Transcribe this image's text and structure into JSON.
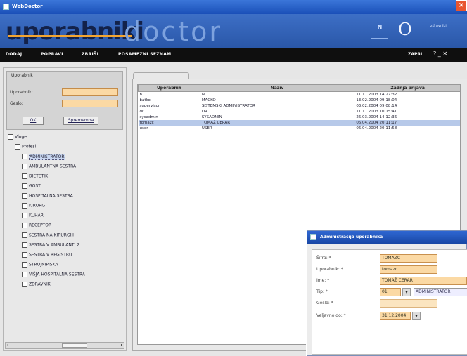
{
  "window": {
    "title": "WebDoctor"
  },
  "banner": {
    "logo_primary": "uporabniki",
    "logo_secondary": "doctor",
    "brand_n": "N",
    "brand_o": "O",
    "brand_text": "zdravniki"
  },
  "menu": {
    "items": [
      "DODAJ",
      "POPRAVI",
      "ZBRIŠI",
      "POSAMEZNI SEZNAM"
    ],
    "exit_label": "ZAPRI"
  },
  "login": {
    "legend": "Uporabnik",
    "username_label": "Uporabnik:",
    "password_label": "Geslo:",
    "username_value": "",
    "password_value": "",
    "ok_label": "OK",
    "change_label": "Sprememba"
  },
  "tree": {
    "root": "Vloge",
    "group": "Profesi",
    "items": [
      "ADMINISTRATOR",
      "AMBULANTNA SESTRA",
      "DIETETIK",
      "GOST",
      "HOSPITALNA SESTRA",
      "KIRURG",
      "KUHAR",
      "RECEPTOR",
      "SESTRA NA KIRURGIJI",
      "SESTRA V AMBULANTI 2",
      "SESTRA V REGISTRU",
      "STROJNIPISKA",
      "VIŠJA HOSPITALNA SESTRA",
      "ZDRAVNIK"
    ]
  },
  "grid": {
    "columns": [
      "Uporabnik",
      "Naziv",
      "Zadnja prijava"
    ],
    "rows": [
      [
        "n",
        "N",
        "11.11.2003 14:27:32"
      ],
      [
        "batko",
        "MAČKO",
        "13.02.2004 09:18:04"
      ],
      [
        "supervisor",
        "SISTEMSKI ADMINISTRATOR",
        "03.02.2004 09:08:14"
      ],
      [
        "dr",
        "DR",
        "11.11.2003 10:15:41"
      ],
      [
        "sysadmin",
        "SYSADMIN",
        "26.03.2004 14:12:36"
      ],
      [
        "tomazc",
        "TOMAŽ CERAR",
        "06.04.2004 20:11:17"
      ],
      [
        "user",
        "USER",
        "06.04.2004 20:11:58"
      ]
    ],
    "selected_row": 5
  },
  "dialog": {
    "title": "Administracija uporabnika",
    "fields": {
      "name_label": "Šifra: *",
      "name_value": "TOMAZC",
      "user_label": "Uporabnik: *",
      "user_value": "tomazc",
      "fullname_label": "Ime: *",
      "fullname_value": "TOMAŽ CERAR",
      "type_label": "Tip: *",
      "type_value": "01",
      "type_link": "ADMINISTRATOR",
      "password_label": "Geslo: *",
      "password_value": "",
      "valid_label": "Veljavno do: *",
      "valid_value": "31.12.2004"
    }
  }
}
